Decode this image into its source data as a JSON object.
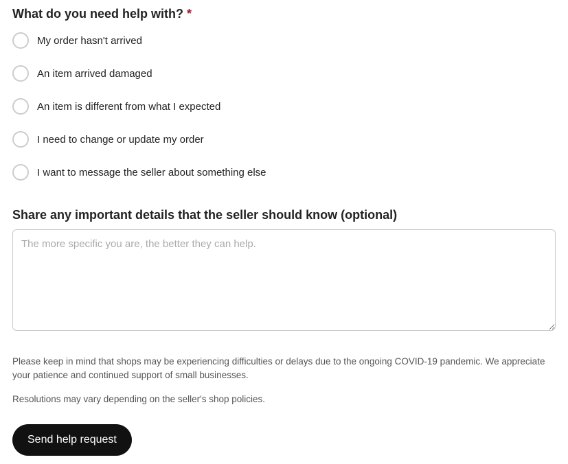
{
  "form": {
    "question_label": "What do you need help with?",
    "required_mark": "*",
    "options": [
      "My order hasn't arrived",
      "An item arrived damaged",
      "An item is different from what I expected",
      "I need to change or update my order",
      "I want to message the seller about something else"
    ],
    "details_label": "Share any important details that the seller should know (optional)",
    "details_placeholder": "The more specific you are, the better they can help.",
    "disclaimer_1": "Please keep in mind that shops may be experiencing difficulties or delays due to the ongoing COVID-19 pandemic. We appreciate your patience and continued support of small businesses.",
    "disclaimer_2": "Resolutions may vary depending on the seller's shop policies.",
    "submit_label": "Send help request"
  }
}
